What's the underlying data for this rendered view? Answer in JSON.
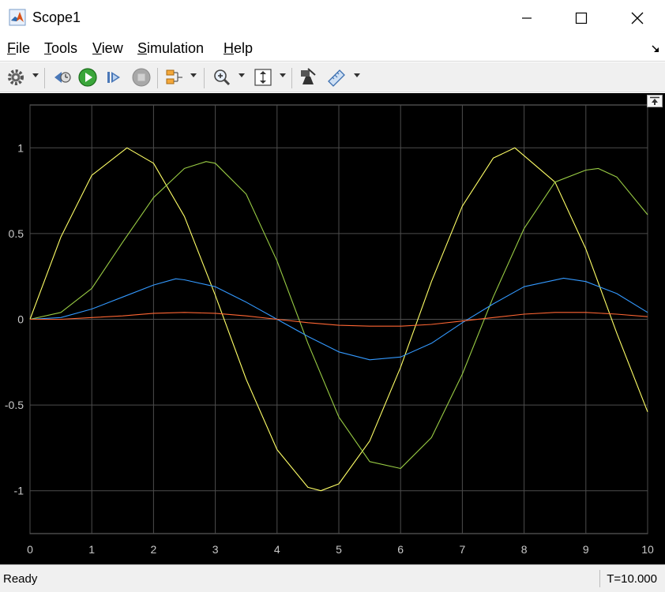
{
  "window": {
    "title": "Scope1",
    "controls": [
      "minimize",
      "maximize",
      "close"
    ]
  },
  "menu": {
    "items": [
      "File",
      "Tools",
      "View",
      "Simulation",
      "Help"
    ]
  },
  "toolbar": {
    "icons": [
      "settings-icon",
      "step-back-icon",
      "run-icon",
      "step-forward-icon",
      "stop-icon",
      "signal-selector-icon",
      "zoom-icon",
      "scale-axes-icon",
      "highlight-simulink-block-icon",
      "measurements-icon"
    ]
  },
  "status": {
    "text": "Ready",
    "time": "T=10.000"
  },
  "colors": {
    "plot_background": "#000000",
    "grid": "#4d4d4d",
    "axis_text": "#c8c8c8",
    "series_yellow": "#ffff66",
    "series_green": "#99cc44",
    "series_blue": "#3399ff",
    "series_red": "#ff6633"
  },
  "chart_data": {
    "type": "line",
    "title": "",
    "xlabel": "",
    "ylabel": "",
    "xlim": [
      0,
      10
    ],
    "ylim": [
      -1.25,
      1.25
    ],
    "xticks": [
      0,
      1,
      2,
      3,
      4,
      5,
      6,
      7,
      8,
      9,
      10
    ],
    "yticks": [
      1,
      0.5,
      0,
      -0.5,
      -1
    ],
    "ytick_labels": [
      "1",
      "0.5",
      "0",
      "-0.5",
      "-1"
    ],
    "grid": true,
    "series": [
      {
        "color": "#ffff66",
        "x": [
          0,
          0.5,
          1,
          1.57,
          2,
          2.5,
          3,
          3.5,
          4,
          4.5,
          4.71,
          5,
          5.5,
          6,
          6.5,
          7,
          7.5,
          7.85,
          8.5,
          9,
          9.5,
          10
        ],
        "values": [
          0,
          0.48,
          0.84,
          1.0,
          0.91,
          0.6,
          0.14,
          -0.35,
          -0.76,
          -0.98,
          -1.0,
          -0.96,
          -0.71,
          -0.28,
          0.22,
          0.66,
          0.94,
          1.0,
          0.8,
          0.41,
          -0.08,
          -0.54
        ]
      },
      {
        "color": "#99cc44",
        "x": [
          0,
          0.5,
          1,
          1.5,
          2,
          2.5,
          2.85,
          3,
          3.5,
          4,
          4.5,
          5,
          5.5,
          6,
          6.5,
          7,
          7.5,
          8,
          8.5,
          9,
          9.2,
          9.5,
          10
        ],
        "values": [
          0,
          0.04,
          0.18,
          0.45,
          0.71,
          0.88,
          0.92,
          0.91,
          0.73,
          0.34,
          -0.14,
          -0.57,
          -0.83,
          -0.87,
          -0.69,
          -0.32,
          0.13,
          0.53,
          0.8,
          0.87,
          0.88,
          0.83,
          0.61
        ]
      },
      {
        "color": "#3399ff",
        "x": [
          0,
          0.5,
          1,
          1.5,
          2,
          2.36,
          2.5,
          3,
          3.5,
          4,
          4.5,
          5,
          5.5,
          6,
          6.5,
          7,
          7.5,
          8,
          8.64,
          9,
          9.5,
          10
        ],
        "values": [
          0,
          0.01,
          0.06,
          0.13,
          0.2,
          0.236,
          0.23,
          0.19,
          0.1,
          0.0,
          -0.1,
          -0.19,
          -0.236,
          -0.22,
          -0.14,
          -0.02,
          0.09,
          0.19,
          0.24,
          0.22,
          0.15,
          0.04
        ]
      },
      {
        "color": "#ff6633",
        "x": [
          0,
          0.5,
          1,
          1.5,
          2,
          2.5,
          3,
          3.5,
          4,
          4.5,
          5,
          5.5,
          6,
          6.5,
          7,
          7.5,
          8,
          8.5,
          9,
          9.5,
          10
        ],
        "values": [
          0,
          0.0,
          0.01,
          0.02,
          0.035,
          0.04,
          0.035,
          0.02,
          0.0,
          -0.02,
          -0.035,
          -0.04,
          -0.04,
          -0.03,
          -0.01,
          0.01,
          0.03,
          0.04,
          0.04,
          0.03,
          0.015
        ]
      }
    ]
  }
}
